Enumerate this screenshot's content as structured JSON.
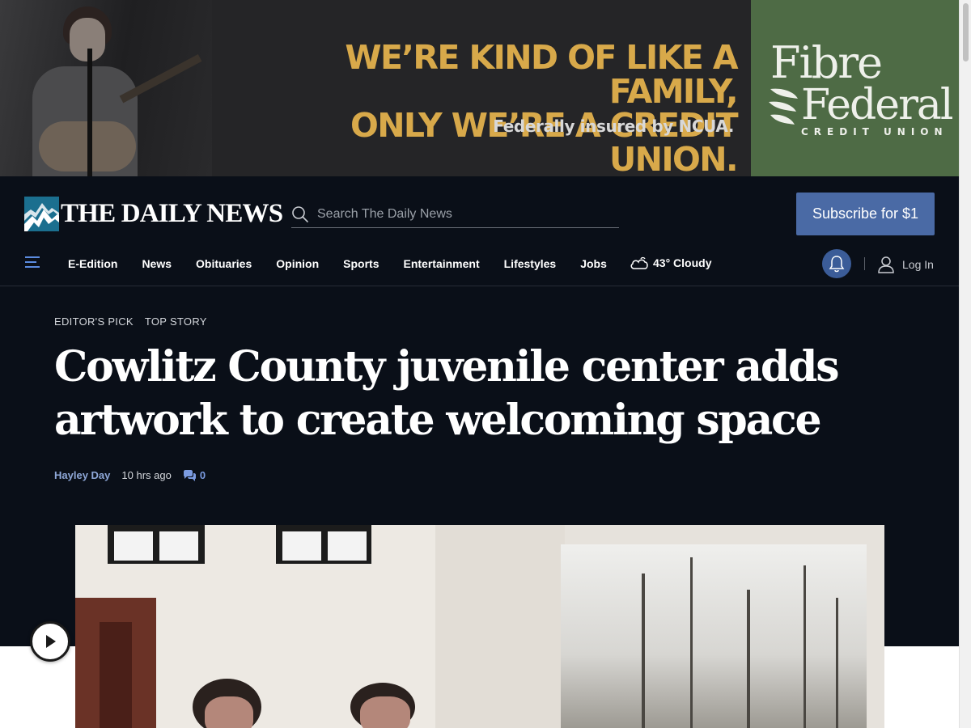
{
  "ad": {
    "headline_line1": "WE’RE KIND OF LIKE A FAMILY,",
    "headline_line2": "ONLY WE’RE A CREDIT UNION.",
    "subline": "Federally insured by NCUA.",
    "logo_line1": "Fibre",
    "logo_line2": "Federal",
    "logo_line3": "CREDIT UNION",
    "headline_color": "#d8a94a",
    "logo_bg_color": "#4e6b45"
  },
  "header": {
    "logo_text": "THE DAILY NEWS",
    "search_placeholder": "Search The Daily News",
    "subscribe_label": "Subscribe for $1",
    "accent_color": "#4a6aa5"
  },
  "nav": {
    "items": [
      "E-Edition",
      "News",
      "Obituaries",
      "Opinion",
      "Sports",
      "Entertainment",
      "Lifestyles",
      "Jobs"
    ],
    "weather": "43° Cloudy",
    "login_label": "Log In"
  },
  "article": {
    "tags": [
      "EDITOR'S PICK",
      "TOP STORY"
    ],
    "headline": "Cowlitz County juvenile center adds artwork to create welcoming space",
    "author": "Hayley Day",
    "time": "10 hrs ago",
    "comment_count": "0"
  },
  "icons": {
    "search": "search-icon",
    "menu": "menu-icon",
    "weather": "cloud-sun-icon",
    "notifications": "bell-icon",
    "account": "user-icon",
    "comments": "comments-icon",
    "media": "play-icon"
  }
}
